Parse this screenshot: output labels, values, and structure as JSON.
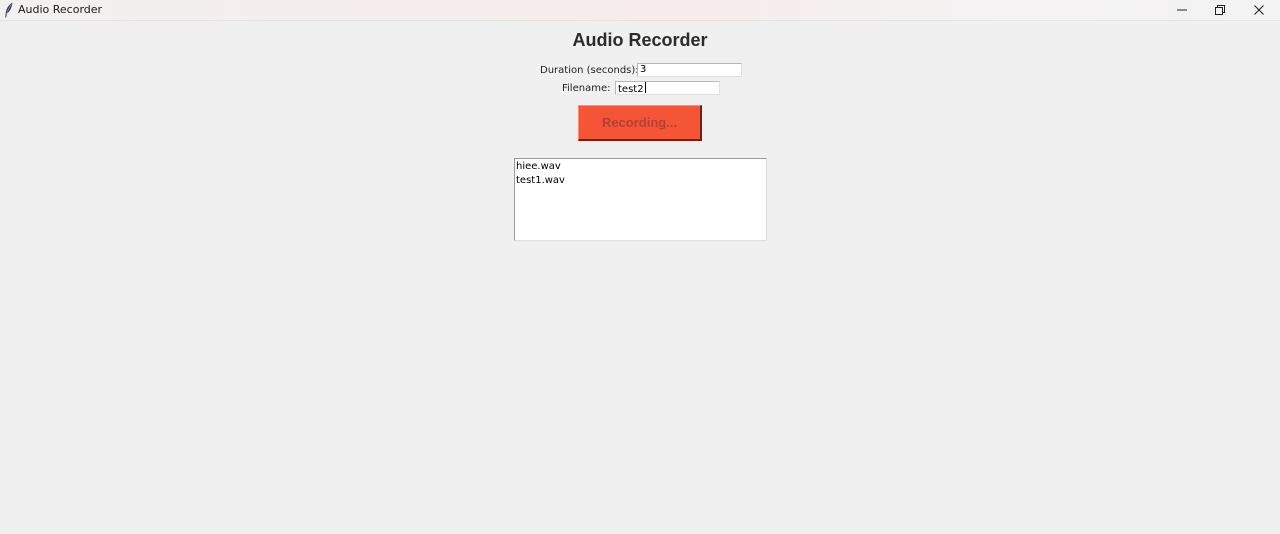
{
  "window": {
    "title": "Audio Recorder",
    "app_icon": "feather-icon",
    "controls": {
      "minimize_icon": "minimize-icon",
      "maximize_icon": "restore-icon",
      "close_icon": "close-icon"
    }
  },
  "main": {
    "heading": "Audio Recorder",
    "duration": {
      "label": "Duration (seconds):",
      "value": "3"
    },
    "filename": {
      "label": "Filename:",
      "value": "test2"
    },
    "record_button": {
      "label": "Recording...",
      "color": "#f45536"
    },
    "recordings": [
      "hiee.wav",
      "test1.wav"
    ]
  }
}
